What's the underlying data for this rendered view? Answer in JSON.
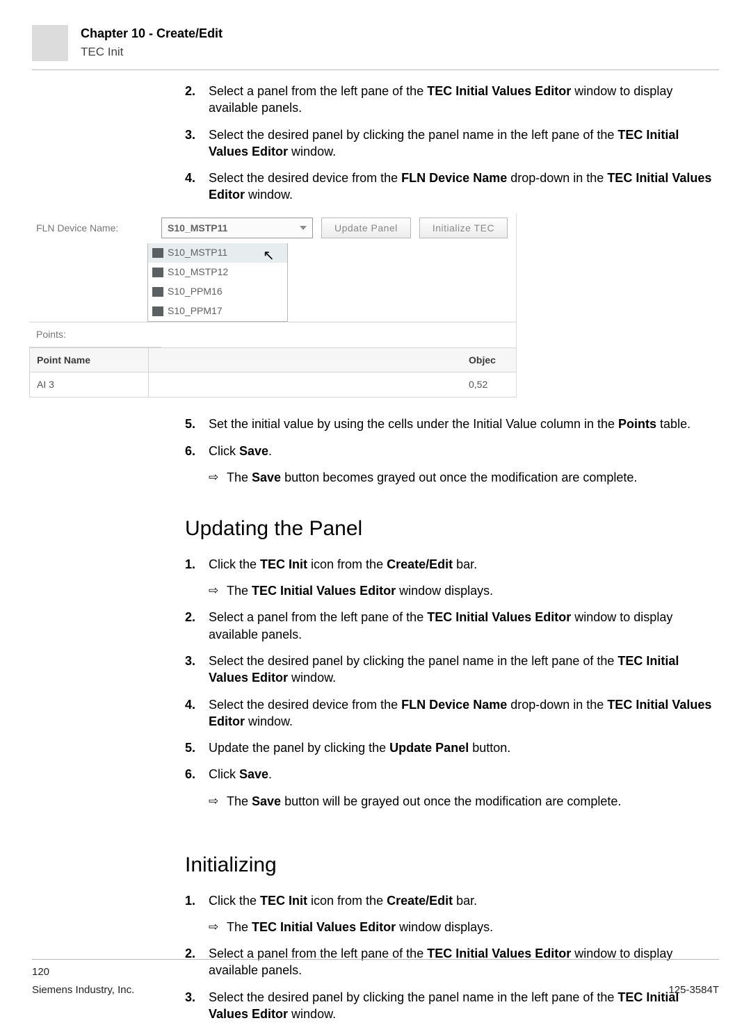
{
  "header": {
    "chapter": "Chapter 10 - Create/Edit",
    "section": "TEC Init"
  },
  "intro_steps": [
    {
      "n": "2.",
      "parts": [
        "Select a panel from the left pane of the ",
        "TEC Initial Values Editor",
        " window to display available panels."
      ]
    },
    {
      "n": "3.",
      "parts": [
        "Select the desired panel by clicking the panel name in the left pane of the ",
        "TEC Initial Values Editor",
        " window."
      ]
    },
    {
      "n": "4.",
      "parts": [
        "Select the desired device from the ",
        "FLN Device Name",
        " drop-down in the ",
        "TEC Initial Values Editor",
        " window."
      ]
    }
  ],
  "shot": {
    "fln_label": "FLN Device Name:",
    "selected": "S10_MSTP11",
    "btn_update": "Update Panel",
    "btn_init": "Initialize TEC",
    "options": [
      "S10_MSTP11",
      "S10_MSTP12",
      "S10_PPM16",
      "S10_PPM17"
    ],
    "points_label": "Points:",
    "col_point": "Point Name",
    "col_obj": "Objec",
    "row_point": "AI 3",
    "row_obj": "0,52"
  },
  "post_steps": [
    {
      "n": "5.",
      "parts": [
        "Set the initial value by using the cells under the Initial Value column in the ",
        "Points",
        " table."
      ]
    },
    {
      "n": "6.",
      "parts": [
        "Click ",
        "Save",
        "."
      ]
    }
  ],
  "post_result": [
    "The ",
    "Save",
    " button becomes grayed out once the modification are complete."
  ],
  "updating": {
    "title": "Updating the Panel",
    "steps": [
      {
        "n": "1.",
        "parts": [
          "Click the ",
          "TEC Init",
          " icon from the ",
          "Create/Edit",
          " bar."
        ],
        "result": [
          "The ",
          "TEC Initial Values Editor",
          " window displays."
        ]
      },
      {
        "n": "2.",
        "parts": [
          "Select a panel from the left pane of the ",
          "TEC Initial Values Editor",
          " window to display available panels."
        ]
      },
      {
        "n": "3.",
        "parts": [
          "Select the desired panel by clicking the panel name in the left pane of the ",
          "TEC Initial Values Editor",
          " window."
        ]
      },
      {
        "n": "4.",
        "parts": [
          "Select the desired device from the ",
          "FLN Device Name",
          " drop-down in the ",
          "TEC Initial Values Editor",
          " window."
        ]
      },
      {
        "n": "5.",
        "parts": [
          "Update the panel by clicking the ",
          "Update Panel",
          " button."
        ]
      },
      {
        "n": "6.",
        "parts": [
          "Click ",
          "Save",
          "."
        ],
        "result": [
          "The ",
          "Save",
          " button will be grayed out once the modification are complete."
        ]
      }
    ]
  },
  "initializing": {
    "title": "Initializing",
    "steps": [
      {
        "n": "1.",
        "parts": [
          "Click the ",
          "TEC Init",
          " icon from the ",
          "Create/Edit",
          " bar."
        ],
        "result": [
          "The ",
          "TEC Initial Values Editor",
          " window displays."
        ]
      },
      {
        "n": "2.",
        "parts": [
          "Select a panel from the left pane of the ",
          "TEC Initial Values Editor",
          " window to display available panels."
        ]
      },
      {
        "n": "3.",
        "parts": [
          "Select the desired panel by clicking the panel name in the left pane of the ",
          "TEC Initial Values Editor",
          " window."
        ]
      }
    ]
  },
  "footer": {
    "page": "120",
    "left": "Siemens Industry, Inc.",
    "right": "125-3584T"
  }
}
